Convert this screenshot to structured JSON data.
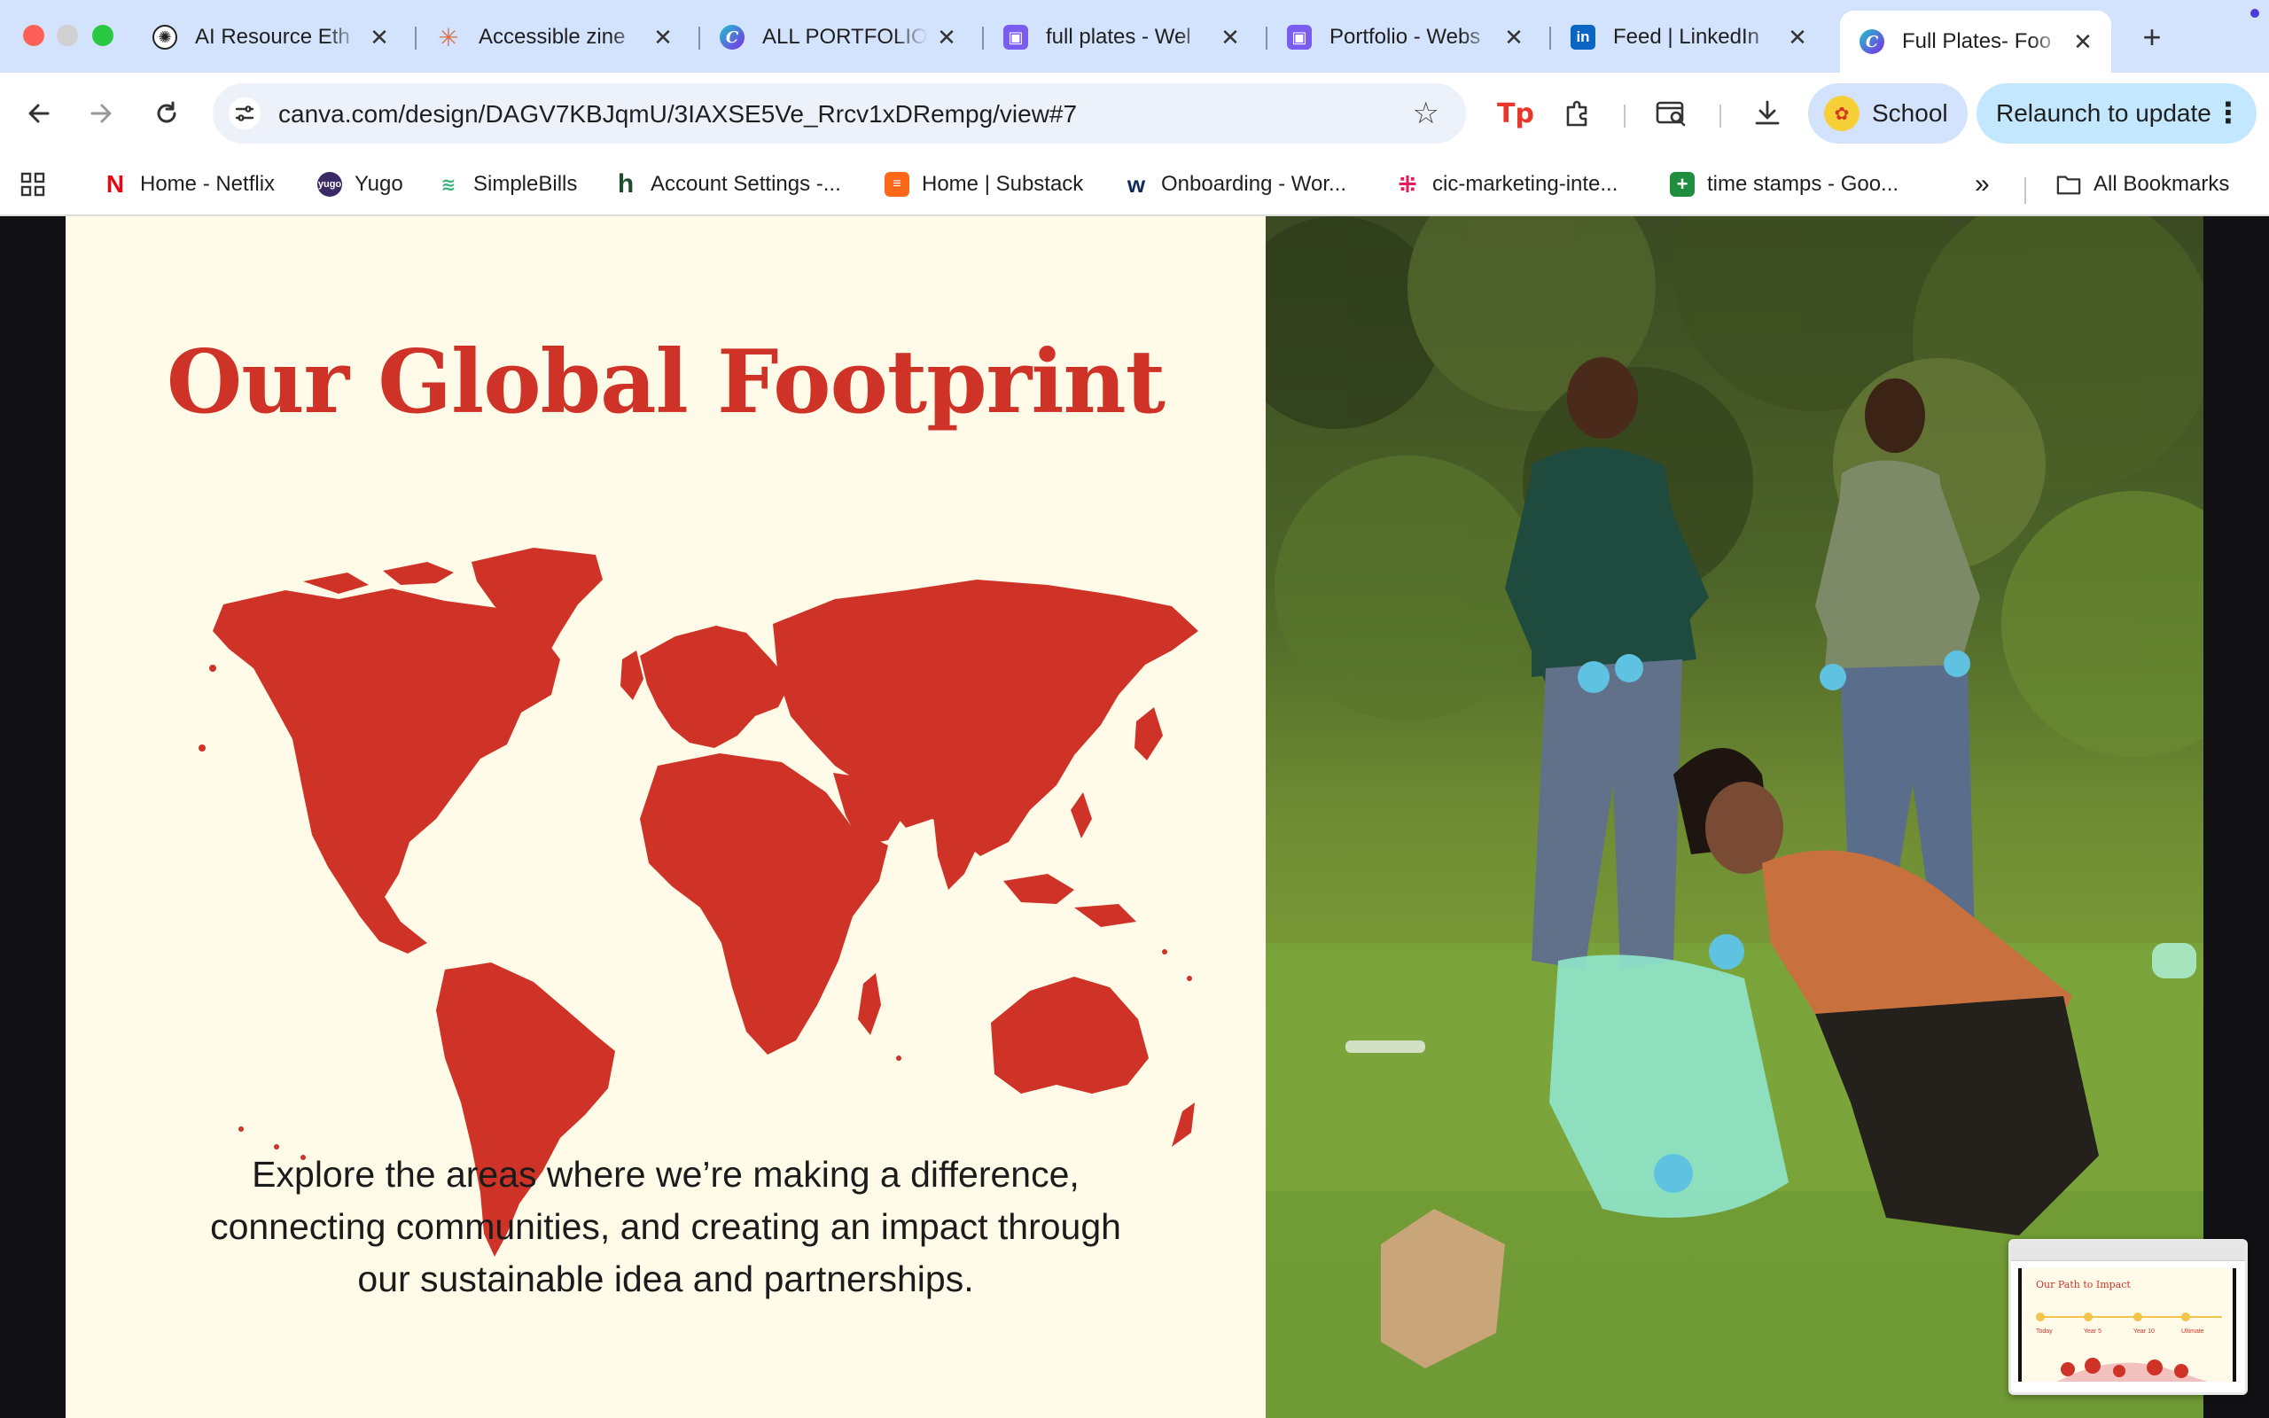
{
  "window": {
    "buttons": [
      "close",
      "minimize",
      "zoom"
    ]
  },
  "tabs": [
    {
      "title": "AI Resource Eth",
      "icon": "openai-icon",
      "active": false
    },
    {
      "title": "Accessible zine",
      "icon": "claude-icon",
      "active": false
    },
    {
      "title": "ALL PORTFOLIO",
      "icon": "canva-icon",
      "active": false
    },
    {
      "title": "full plates - Wel",
      "icon": "webflow-app-icon",
      "active": false
    },
    {
      "title": "Portfolio - Webs",
      "icon": "webflow-app-icon",
      "active": false
    },
    {
      "title": "Feed | LinkedIn",
      "icon": "linkedin-icon",
      "active": false
    },
    {
      "title": "Full Plates- Foo",
      "icon": "canva-icon",
      "active": true
    }
  ],
  "toolbar": {
    "url": "canva.com/design/DAGV7KBJqmU/3IAXSE5Ve_Rrcv1xDRempg/view#7",
    "profile_label": "School",
    "relaunch_label": "Relaunch to update"
  },
  "bookmarks": [
    {
      "label": "Home - Netflix",
      "icon": "netflix-icon",
      "color": "#e50914"
    },
    {
      "label": "Yugo",
      "icon": "yugo-icon",
      "color": "#3a2a66"
    },
    {
      "label": "SimpleBills",
      "icon": "simplebills-icon",
      "color": "#3bb27a"
    },
    {
      "label": "Account Settings -...",
      "icon": "h-icon",
      "color": "#1f4d2c"
    },
    {
      "label": "Home | Substack",
      "icon": "substack-icon",
      "color": "#ff6719"
    },
    {
      "label": "Onboarding - Wor...",
      "icon": "workday-icon",
      "color": "#0875e1"
    },
    {
      "label": "cic-marketing-inte...",
      "icon": "slack-icon",
      "color": "#e01e5a"
    },
    {
      "label": "time stamps - Goo...",
      "icon": "google-sheets-icon",
      "color": "#1e8e3e"
    }
  ],
  "bookmarks_overflow": "»",
  "all_bookmarks_label": "All Bookmarks",
  "slide": {
    "title": "Our Global Footprint",
    "body": "Explore the areas where we’re making a difference, connecting communities, and creating an impact through our sustainable idea and partnerships.",
    "accent_color": "#cf3327",
    "background_color": "#fffbe8",
    "photo_description_icon": "volunteers-cleanup-photo"
  },
  "thumbnail": {
    "title": "Our Path to Impact",
    "labels": [
      "Today",
      "Year 5",
      "Year 10",
      "Ultimate"
    ]
  }
}
